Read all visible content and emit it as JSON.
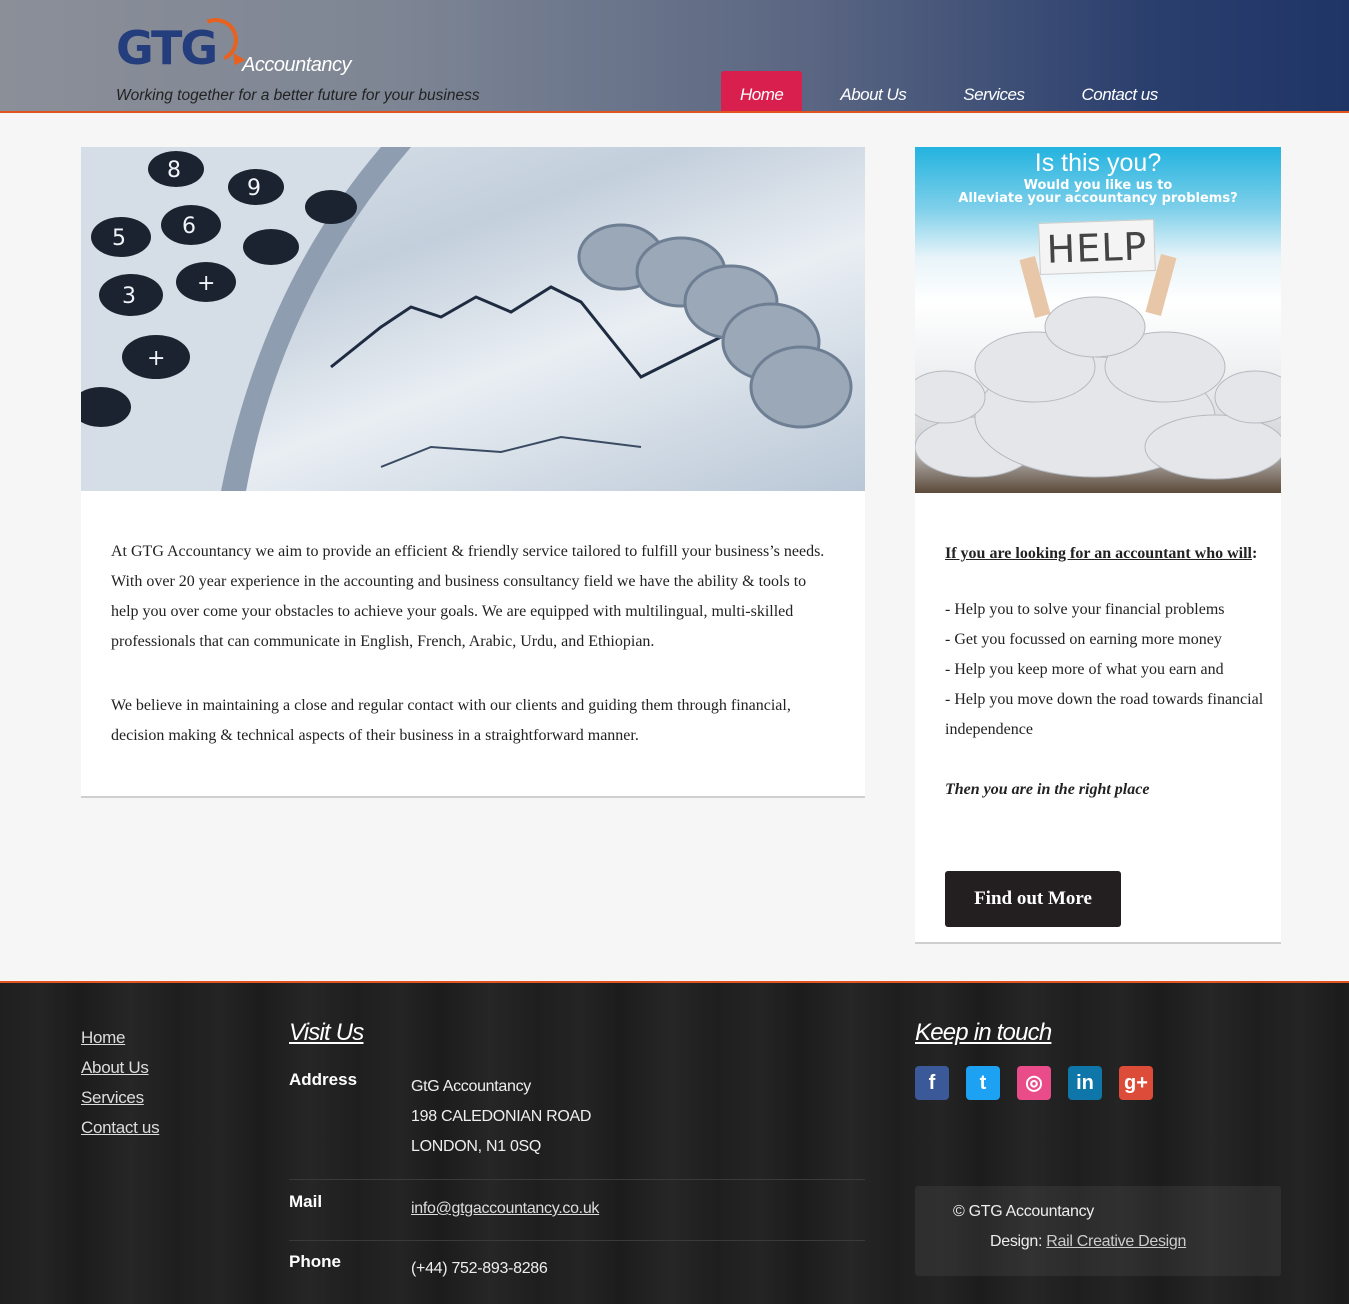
{
  "brand": {
    "logo_text": "GTG",
    "name_suffix": "Accountancy",
    "tagline": "Working together for a better future for your business",
    "accent": "#e2541f",
    "nav_active_color": "#d91f4e"
  },
  "nav": [
    {
      "label": "Home",
      "active": true
    },
    {
      "label": "About Us",
      "active": false
    },
    {
      "label": "Services",
      "active": false
    },
    {
      "label": "Contact us",
      "active": false
    }
  ],
  "main": {
    "paragraph1": "At GTG Accountancy we aim to provide an efficient & friendly service tailored to fulfill your business’s needs. With over 20 year experience in the accounting and business consultancy field we have the ability & tools to help you over come your obstacles to achieve your goals. We are equipped with multilingual, multi-skilled professionals that can communicate in English, French, Arabic, Urdu, and Ethiopian.",
    "paragraph2": "We believe in maintaining a close and regular contact with our clients and guiding them through financial, decision making & technical aspects of their business in a straightforward manner."
  },
  "side": {
    "image": {
      "line1": "Is this you?",
      "line2": "Would you like us to",
      "line3": "Alleviate your accountancy problems?",
      "sign": "HELP"
    },
    "heading": "If you are looking for an accountant who will",
    "heading_colon": ":",
    "items": [
      "- Help you to solve your financial problems",
      "- Get you focussed on earning more money",
      "- Help you keep more of what you earn and",
      "- Help you move down the road towards financial independence"
    ],
    "closing": "Then you are in the right place",
    "button": "Find out More"
  },
  "footer": {
    "links": [
      "Home",
      "About Us",
      "Services",
      "Contact us"
    ],
    "visit_title": "Visit Us",
    "address_label": "Address",
    "address_lines": [
      "GtG Accountancy",
      "198 CALEDONIAN ROAD",
      "LONDON, N1 0SQ"
    ],
    "mail_label": "Mail",
    "mail_value": "info@gtgaccountancy.co.uk",
    "phone_label": "Phone",
    "phone_value": "(+44) 752-893-8286",
    "keep_title": "Keep in touch",
    "social": [
      {
        "icon": "facebook-icon",
        "glyph": "f"
      },
      {
        "icon": "twitter-icon",
        "glyph": "t"
      },
      {
        "icon": "dribbble-icon",
        "glyph": "◎"
      },
      {
        "icon": "linkedin-icon",
        "glyph": "in"
      },
      {
        "icon": "google-plus-icon",
        "glyph": "g+"
      }
    ],
    "copyright": "© GTG Accountancy",
    "design_prefix": "Design: ",
    "design_link": "Rail Creative Design"
  }
}
